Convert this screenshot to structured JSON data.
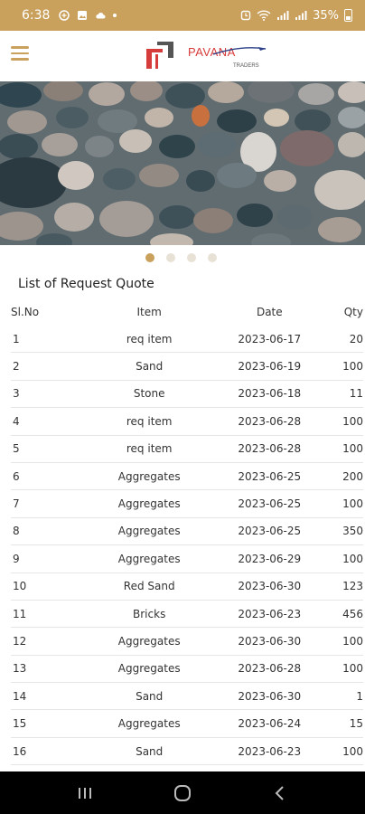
{
  "status_bar": {
    "time": "6:38",
    "battery": "35%"
  },
  "header": {
    "brand_name": "PAVANA",
    "brand_sub": "TRADERS",
    "menu_icon": "hamburger-menu-icon"
  },
  "banner": {
    "slides_count": 4,
    "active_slide": 1
  },
  "list": {
    "title": "List of Request Quote",
    "columns": [
      "Sl.No",
      "Item",
      "Date",
      "Qty"
    ],
    "rows": [
      {
        "sl": "1",
        "item": "req item",
        "date": "2023-06-17",
        "qty": "20"
      },
      {
        "sl": "2",
        "item": "Sand",
        "date": "2023-06-19",
        "qty": "100"
      },
      {
        "sl": "3",
        "item": "Stone",
        "date": "2023-06-18",
        "qty": "11"
      },
      {
        "sl": "4",
        "item": "req item",
        "date": "2023-06-28",
        "qty": "100"
      },
      {
        "sl": "5",
        "item": "req item",
        "date": "2023-06-28",
        "qty": "100"
      },
      {
        "sl": "6",
        "item": "Aggregates",
        "date": "2023-06-25",
        "qty": "200"
      },
      {
        "sl": "7",
        "item": "Aggregates",
        "date": "2023-06-25",
        "qty": "100"
      },
      {
        "sl": "8",
        "item": "Aggregates",
        "date": "2023-06-25",
        "qty": "350"
      },
      {
        "sl": "9",
        "item": "Aggregates",
        "date": "2023-06-29",
        "qty": "100"
      },
      {
        "sl": "10",
        "item": "Red Sand",
        "date": "2023-06-30",
        "qty": "123"
      },
      {
        "sl": "11",
        "item": "Bricks",
        "date": "2023-06-23",
        "qty": "456"
      },
      {
        "sl": "12",
        "item": "Aggregates",
        "date": "2023-06-30",
        "qty": "100"
      },
      {
        "sl": "13",
        "item": "Aggregates",
        "date": "2023-06-28",
        "qty": "100"
      },
      {
        "sl": "14",
        "item": "Sand",
        "date": "2023-06-30",
        "qty": "1"
      },
      {
        "sl": "15",
        "item": "Aggregates",
        "date": "2023-06-24",
        "qty": "15"
      },
      {
        "sl": "16",
        "item": "Sand",
        "date": "2023-06-23",
        "qty": "100"
      }
    ]
  },
  "colors": {
    "accent": "#c9a15c",
    "brand_red": "#d73c3c"
  },
  "nav_bar": {
    "icons": [
      "recent-apps-icon",
      "home-icon",
      "back-icon"
    ]
  }
}
